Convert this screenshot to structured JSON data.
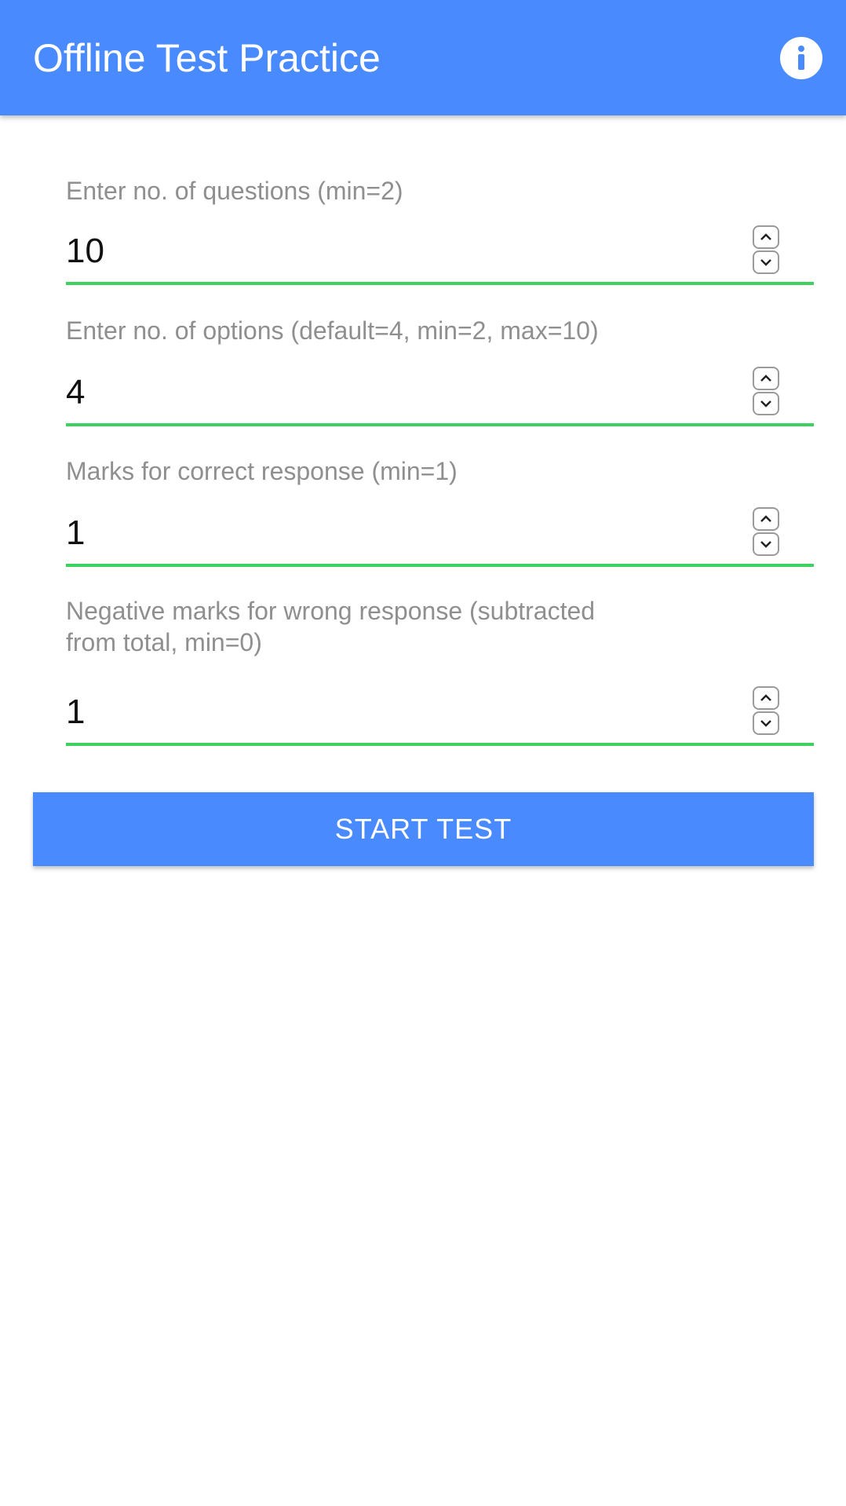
{
  "appbar": {
    "title": "Offline Test Practice",
    "info_icon": "info-icon",
    "color": "#4a8aff"
  },
  "fields": [
    {
      "label": "Enter no. of questions (min=2)",
      "value": "10"
    },
    {
      "label": "Enter no. of options (default=4, min=2, max=10)",
      "value": "4"
    },
    {
      "label": "Marks for correct response (min=1)",
      "value": "1"
    },
    {
      "label": "Negative marks for wrong response (subtracted from total, min=0)",
      "value": "1"
    }
  ],
  "stepper_icons": {
    "up": "chevron-up-icon",
    "down": "chevron-down-icon"
  },
  "start_button": {
    "label": "START TEST"
  },
  "colors": {
    "accent": "#4a8aff",
    "underline": "#3ed160",
    "label": "#8f8f8f"
  }
}
